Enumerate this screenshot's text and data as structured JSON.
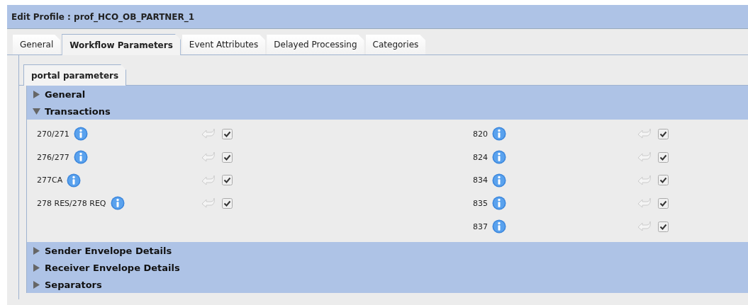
{
  "window": {
    "title": "Edit Profile : prof_HCO_OB_PARTNER_1"
  },
  "tabs": [
    {
      "label": "General",
      "selected": false
    },
    {
      "label": "Workflow Parameters",
      "selected": true
    },
    {
      "label": "Event Attributes",
      "selected": false
    },
    {
      "label": "Delayed Processing",
      "selected": false
    },
    {
      "label": "Categories",
      "selected": false
    }
  ],
  "subtabs": [
    {
      "label": "portal parameters",
      "selected": true
    }
  ],
  "sections": [
    {
      "title": "General",
      "expanded": false
    },
    {
      "title": "Transactions",
      "expanded": true,
      "columns": [
        [
          {
            "label": "270/271",
            "checked": true
          },
          {
            "label": "276/277",
            "checked": true
          },
          {
            "label": "277CA",
            "checked": true
          },
          {
            "label": "278 RES/278 REQ",
            "checked": true
          }
        ],
        [
          {
            "label": "820",
            "checked": true
          },
          {
            "label": "824",
            "checked": true
          },
          {
            "label": "834",
            "checked": true
          },
          {
            "label": "835",
            "checked": true
          },
          {
            "label": "837",
            "checked": true
          }
        ]
      ]
    },
    {
      "title": "Sender Envelope Details",
      "expanded": false
    },
    {
      "title": "Receiver Envelope Details",
      "expanded": false
    },
    {
      "title": "Separators",
      "expanded": false
    }
  ]
}
